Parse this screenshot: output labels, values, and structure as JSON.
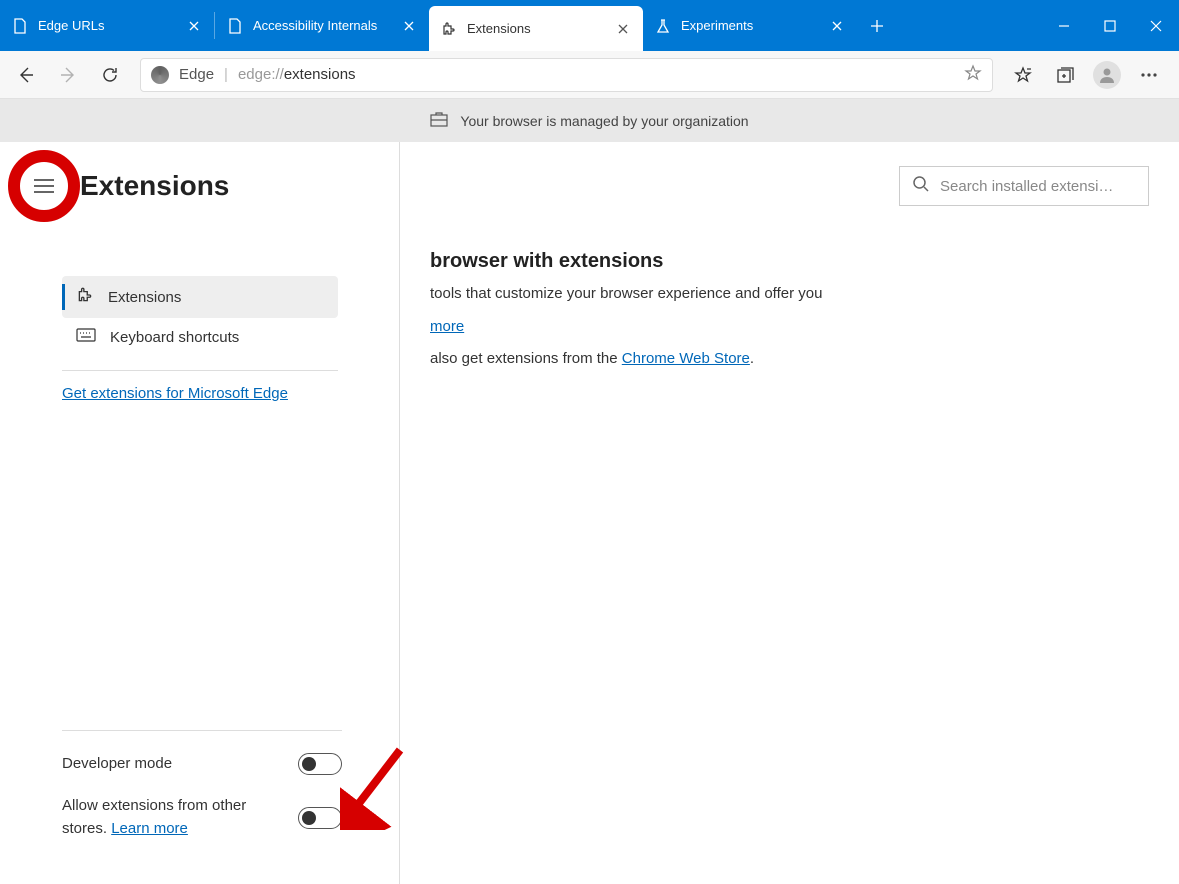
{
  "tabs": [
    {
      "label": "Edge URLs"
    },
    {
      "label": "Accessibility Internals"
    },
    {
      "label": "Extensions"
    },
    {
      "label": "Experiments"
    }
  ],
  "address": {
    "label": "Edge",
    "url_prefix": "edge://",
    "url_path": "extensions"
  },
  "managed_banner": "Your browser is managed by your organization",
  "page": {
    "title": "Extensions",
    "nav": {
      "extensions": "Extensions",
      "shortcuts": "Keyboard shortcuts"
    },
    "get_link": "Get extensions for Microsoft Edge",
    "dev_mode": "Developer mode",
    "allow_other": "Allow extensions from other stores. ",
    "learn_more": "Learn more"
  },
  "main": {
    "heading_suffix": "browser with extensions",
    "desc_suffix": " tools that customize your browser experience and offer you",
    "more": "more",
    "store_prefix": "also get extensions from the ",
    "store_link": "Chrome Web Store",
    "search_placeholder": "Search installed extensi…"
  }
}
